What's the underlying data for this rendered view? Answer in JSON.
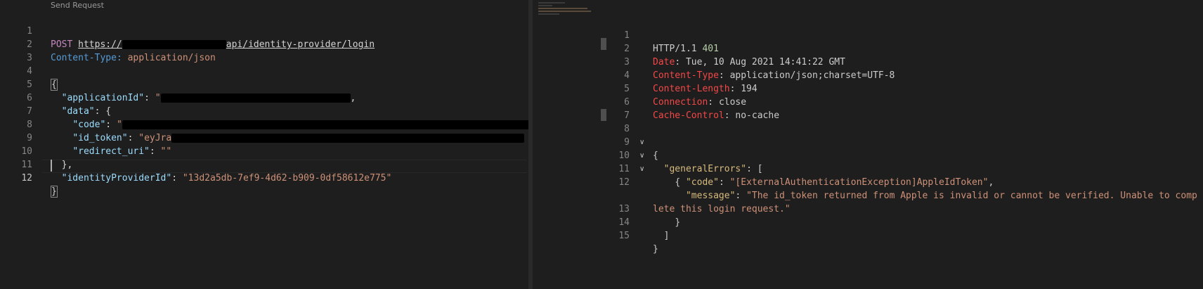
{
  "request": {
    "codelens": "Send Request",
    "lines": [
      {
        "n": "1",
        "method": "POST",
        "url_prefix": "https://",
        "url_suffix": "api/identity-provider/login"
      },
      {
        "n": "2",
        "header": "Content-Type:",
        "value": "application/json"
      },
      {
        "n": "3"
      },
      {
        "n": "4",
        "text": "{"
      },
      {
        "n": "5",
        "key": "\"applicationId\"",
        "sep": ": ",
        "after": ","
      },
      {
        "n": "6",
        "key": "\"data\"",
        "sep": ": ",
        "after": "{"
      },
      {
        "n": "7",
        "key": "\"code\"",
        "sep": ": ",
        "val": "\""
      },
      {
        "n": "8",
        "key": "\"id_token\"",
        "sep": ": ",
        "val": "\"eyJra"
      },
      {
        "n": "9",
        "key": "\"redirect_uri\"",
        "sep": ": ",
        "val": "\"\""
      },
      {
        "n": "10",
        "text": "},"
      },
      {
        "n": "11",
        "key": "\"identityProviderId\"",
        "sep": ": ",
        "val": "\"13d2a5db-7ef9-4d62-b909-0df58612e775\""
      },
      {
        "n": "12",
        "text": "}"
      }
    ]
  },
  "response": {
    "lines": [
      {
        "n": "1",
        "text": "HTTP/1.1 ",
        "status": "401"
      },
      {
        "n": "2",
        "key": "Date",
        "val": "Tue, 10 Aug 2021 14:41:22 GMT"
      },
      {
        "n": "3",
        "key": "Content-Type",
        "val": "application/json;charset=UTF-8"
      },
      {
        "n": "4",
        "key": "Content-Length",
        "val": "194"
      },
      {
        "n": "5",
        "key": "Connection",
        "val": "close"
      },
      {
        "n": "6",
        "key": "Cache-Control",
        "val": "no-cache"
      },
      {
        "n": "7"
      },
      {
        "n": "8",
        "text": "{"
      },
      {
        "n": "9",
        "jkey": "\"generalErrors\"",
        "after": ": ["
      },
      {
        "n": "10",
        "text": "{"
      },
      {
        "n": "11",
        "jkey": "\"code\"",
        "jval": "\"[ExternalAuthenticationException]AppleIdToken\"",
        "after": ","
      },
      {
        "n": "12",
        "jkey": "\"message\"",
        "jval": "\"The id_token returned from Apple is invalid or cannot be verified. Unable to comp"
      },
      {
        "n": "",
        "cont": "lete this login request.\""
      },
      {
        "n": "13",
        "text": "}"
      },
      {
        "n": "14",
        "text": "]"
      },
      {
        "n": "15",
        "text": "}"
      }
    ]
  },
  "colors": {
    "background": "#1e1e1e",
    "keyword": "#c586c0",
    "string": "#ce9178",
    "key": "#9cdcfe"
  }
}
